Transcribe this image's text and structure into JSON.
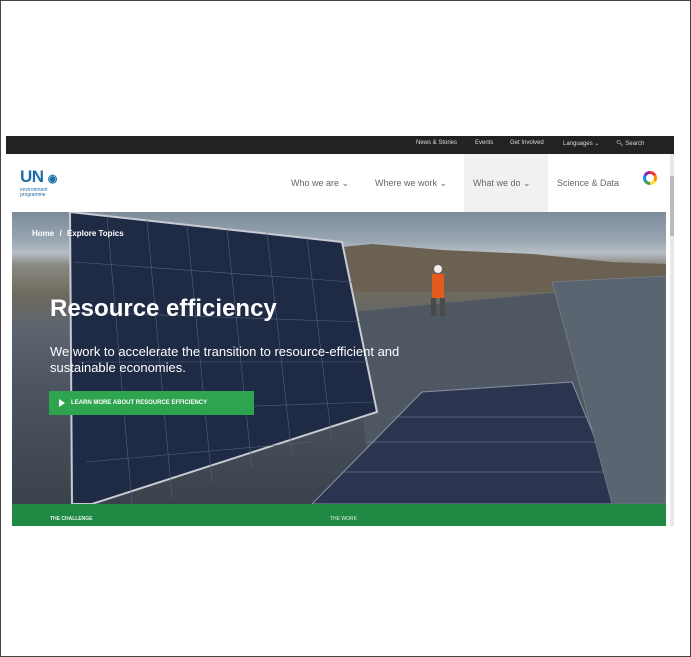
{
  "topbar": {
    "links": [
      "News & Stories",
      "Events",
      "Get Involved"
    ],
    "languages": "Languages",
    "search": "Search"
  },
  "logo": {
    "un": "UN",
    "line1": "environment",
    "line2": "programme"
  },
  "nav": {
    "items": [
      "Who we are",
      "Where we work",
      "What we do",
      "Science & Data"
    ]
  },
  "hero": {
    "breadcrumb": [
      "Home",
      "/",
      "Explore Topics"
    ],
    "title": "Resource efficiency",
    "description": "We work to accelerate the transition to resource-efficient and sustainable economies.",
    "cta_label": "LEARN MORE ABOUT RESOURCE EFFICIENCY"
  },
  "strip": {
    "left": "THE CHALLENGE",
    "right": "THE WORK"
  },
  "colors": {
    "topbar": "#222222",
    "brand_blue": "#1f6fa8",
    "green": "#2ea44f",
    "strip_green": "#1f8a43"
  }
}
